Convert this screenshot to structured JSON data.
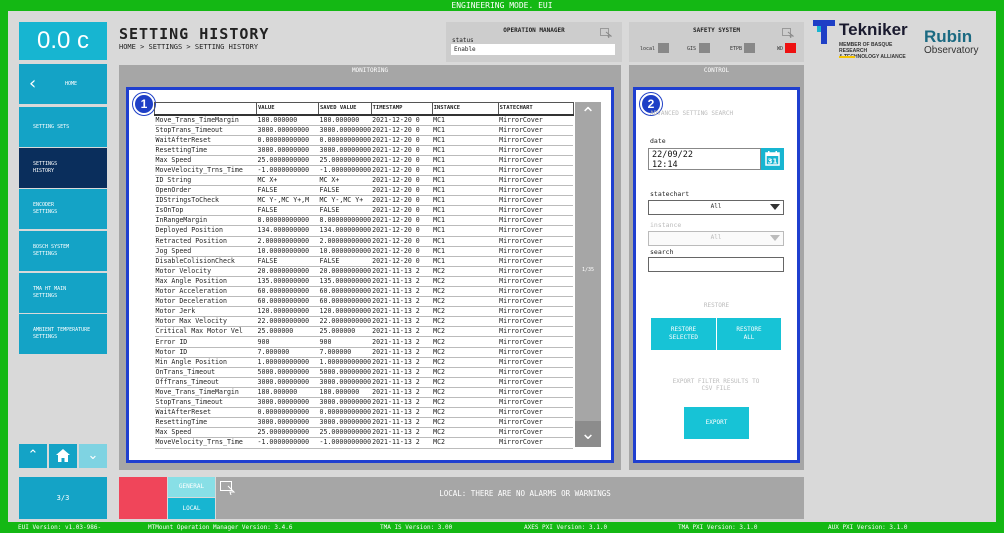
{
  "topbar": {
    "mode": "ENGINEERING MODE. EUI"
  },
  "timer": "0.0 c",
  "nav": {
    "home": "HOME",
    "items": [
      {
        "label": "SETTING SETS",
        "active": false
      },
      {
        "label": "SETTINGS HISTORY",
        "active": true
      },
      {
        "label": "ENCODER SETTINGS",
        "active": false
      },
      {
        "label": "BOSCH SYSTEM SETTINGS",
        "active": false
      },
      {
        "label": "TMA HT MAIN SETTINGS",
        "active": false
      },
      {
        "label": "AMBIENT TEMPERATURE SETTINGS",
        "active": false
      }
    ],
    "page_indicator": "3/3"
  },
  "header": {
    "title": "SETTING HISTORY",
    "breadcrumb": "HOME > SETTINGS > SETTING HISTORY"
  },
  "operation_manager": {
    "title": "OPERATION MANAGER",
    "status_label": "status",
    "status_value": "Enable"
  },
  "safety_system": {
    "title": "SAFETY SYSTEM",
    "indicators": [
      {
        "label": "local",
        "color": "#888888"
      },
      {
        "label": "GIS",
        "color": "#888888"
      },
      {
        "label": "ETPB",
        "color": "#888888"
      },
      {
        "label": "WD",
        "color": "#ee1111"
      }
    ]
  },
  "logos": {
    "tekniker": "Tekniker",
    "tekniker_sub1": "MEMBER OF BASQUE RESEARCH",
    "tekniker_sub2": "& TECHNOLOGY ALLIANCE",
    "rubin1": "Rubin",
    "rubin2": "Observatory"
  },
  "monitoring": {
    "title": "MONITORING",
    "badge": "1",
    "columns": [
      "",
      "VALUE",
      "SAVED VALUE",
      "TIMESTAMP",
      "INSTANCE",
      "STATECHART"
    ],
    "rows": [
      [
        "Move_Trans_TimeMargin",
        "180.000000",
        "180.000000",
        "2021-12-20 0",
        "MC1",
        "MirrorCover"
      ],
      [
        "StopTrans_Timeout",
        "3000.00000000",
        "3000.00000000",
        "2021-12-20 0",
        "MC1",
        "MirrorCover"
      ],
      [
        "WaitAfterReset",
        "0.00000000000",
        "0.00000000000",
        "2021-12-20 0",
        "MC1",
        "MirrorCover"
      ],
      [
        "ResettingTime",
        "3000.00000000",
        "3000.00000000",
        "2021-12-20 0",
        "MC1",
        "MirrorCover"
      ],
      [
        "Max Speed",
        "25.0000000000",
        "25.0000000000",
        "2021-12-20 0",
        "MC1",
        "MirrorCover"
      ],
      [
        "MoveVelocity_Trns_Time",
        "-1.0000000000",
        "-1.0000000000",
        "2021-12-20 0",
        "MC1",
        "MirrorCover"
      ],
      [
        "ID String",
        "MC X+",
        "MC X+",
        "2021-12-20 0",
        "MC1",
        "MirrorCover"
      ],
      [
        "OpenOrder",
        "FALSE",
        "FALSE",
        "2021-12-20 0",
        "MC1",
        "MirrorCover"
      ],
      [
        "IDStringsToCheck",
        "MC Y-,MC Y+,M",
        "MC Y-,MC Y+",
        "2021-12-20 0",
        "MC1",
        "MirrorCover"
      ],
      [
        "IsOnTop",
        "FALSE",
        "FALSE",
        "2021-12-20 0",
        "MC1",
        "MirrorCover"
      ],
      [
        "InRangeMargin",
        "8.00000000000",
        "8.00000000000",
        "2021-12-20 0",
        "MC1",
        "MirrorCover"
      ],
      [
        "Deployed Position",
        "134.000000000",
        "134.000000000",
        "2021-12-20 0",
        "MC1",
        "MirrorCover"
      ],
      [
        "Retracted Position",
        "2.00000000000",
        "2.00000000000",
        "2021-12-20 0",
        "MC1",
        "MirrorCover"
      ],
      [
        "Jog Speed",
        "10.0000000000",
        "10.0000000000",
        "2021-12-20 0",
        "MC1",
        "MirrorCover"
      ],
      [
        "DisableColisionCheck",
        "FALSE",
        "FALSE",
        "2021-12-20 0",
        "MC1",
        "MirrorCover"
      ],
      [
        "Motor Velocity",
        "20.0000000000",
        "20.0000000000",
        "2021-11-13 2",
        "MC2",
        "MirrorCover"
      ],
      [
        "Max Angle Position",
        "135.000000000",
        "135.000000000",
        "2021-11-13 2",
        "MC2",
        "MirrorCover"
      ],
      [
        "Motor Acceleration",
        "60.0000000000",
        "60.0000000000",
        "2021-11-13 2",
        "MC2",
        "MirrorCover"
      ],
      [
        "Motor Deceleration",
        "60.0000000000",
        "60.0000000000",
        "2021-11-13 2",
        "MC2",
        "MirrorCover"
      ],
      [
        "Motor Jerk",
        "120.000000000",
        "120.000000000",
        "2021-11-13 2",
        "MC2",
        "MirrorCover"
      ],
      [
        "Motor Max Velocity",
        "22.0000000000",
        "22.0000000000",
        "2021-11-13 2",
        "MC2",
        "MirrorCover"
      ],
      [
        "Critical Max Motor Vel",
        "25.000000",
        "25.000000",
        "2021-11-13 2",
        "MC2",
        "MirrorCover"
      ],
      [
        "Error ID",
        "900",
        "900",
        "2021-11-13 2",
        "MC2",
        "MirrorCover"
      ],
      [
        "Motor ID",
        "7.000000",
        "7.000000",
        "2021-11-13 2",
        "MC2",
        "MirrorCover"
      ],
      [
        "Min Angle Position",
        "1.00000000000",
        "1.00000000000",
        "2021-11-13 2",
        "MC2",
        "MirrorCover"
      ],
      [
        "OnTrans_Timeout",
        "5000.00000000",
        "5000.00000000",
        "2021-11-13 2",
        "MC2",
        "MirrorCover"
      ],
      [
        "OffTrans_Timeout",
        "3000.00000000",
        "3000.00000000",
        "2021-11-13 2",
        "MC2",
        "MirrorCover"
      ],
      [
        "Move_Trans_TimeMargin",
        "180.000000",
        "180.000000",
        "2021-11-13 2",
        "MC2",
        "MirrorCover"
      ],
      [
        "StopTrans_Timeout",
        "3000.00000000",
        "3000.00000000",
        "2021-11-13 2",
        "MC2",
        "MirrorCover"
      ],
      [
        "WaitAfterReset",
        "0.00000000000",
        "0.00000000000",
        "2021-11-13 2",
        "MC2",
        "MirrorCover"
      ],
      [
        "ResettingTime",
        "3000.00000000",
        "3000.00000000",
        "2021-11-13 2",
        "MC2",
        "MirrorCover"
      ],
      [
        "Max Speed",
        "25.0000000000",
        "25.0000000000",
        "2021-11-13 2",
        "MC2",
        "MirrorCover"
      ],
      [
        "MoveVelocity_Trns_Time",
        "-1.0000000000",
        "-1.0000000000",
        "2021-11-13 2",
        "MC2",
        "MirrorCover"
      ]
    ],
    "page": "1/35"
  },
  "control": {
    "title": "CONTROL",
    "badge": "2",
    "advanced_search": "ADVANCED SETTING SEARCH",
    "date_label": "date",
    "date_value": "22/09/22",
    "time_value": "12:14",
    "statechart_label": "statechart",
    "statechart_value": "All",
    "instance_label": "instance",
    "instance_value": "All",
    "search_label": "search",
    "restore_title": "RESTORE",
    "restore_selected": "RESTORE SELECTED",
    "restore_all": "RESTORE ALL",
    "export_text": "EXPORT FILTER RESULTS TO CSV FILE",
    "export_button": "EXPORT"
  },
  "alarms": {
    "general": "GENERAL",
    "local": "LOCAL",
    "message": "LOCAL: THERE ARE NO ALARMS OR WARNINGS"
  },
  "footer": {
    "eui": "EUI Version: v1.03-986-",
    "mtmount": "MTMount Operation Manager Version: 3.4.6",
    "tma_is": "TMA IS Version: 3.00",
    "axes": "AXES PXI Version: 3.1.0",
    "tma_pxi": "TMA PXI Version: 3.1.0",
    "aux": "AUX PXI Version: 3.1.0"
  },
  "colors": {
    "accent": "#17b5d1",
    "frame": "#14b814",
    "active_nav": "#0a2e5c",
    "highlight": "#1f3fcf",
    "alarm": "#f0455a"
  }
}
